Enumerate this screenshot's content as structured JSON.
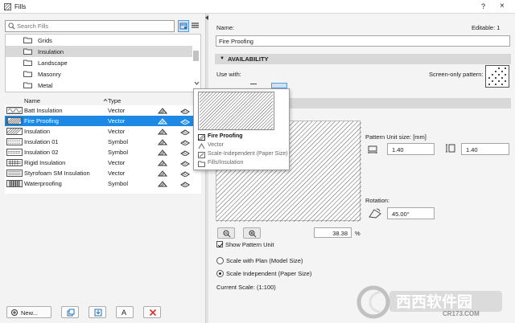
{
  "window": {
    "title": "Fills",
    "help": "?",
    "close": "×"
  },
  "search": {
    "placeholder": "Search Fills",
    "value": ""
  },
  "tree": {
    "items": [
      {
        "label": "Grids",
        "selected": false
      },
      {
        "label": "Insulation",
        "selected": true
      },
      {
        "label": "Landscape",
        "selected": false
      },
      {
        "label": "Masonry",
        "selected": false
      },
      {
        "label": "Metal",
        "selected": false
      }
    ]
  },
  "list": {
    "col_name": "Name",
    "col_type": "Type",
    "rows": [
      {
        "name": "Batt Insulation",
        "type": "Vector",
        "selected": false
      },
      {
        "name": "Fire Proofing",
        "type": "Vector",
        "selected": true
      },
      {
        "name": "Insulation",
        "type": "Vector",
        "selected": false
      },
      {
        "name": "Insulation 01",
        "type": "Symbol",
        "selected": false
      },
      {
        "name": "Insulation 02",
        "type": "Symbol",
        "selected": false
      },
      {
        "name": "Rigid Insulation",
        "type": "Vector",
        "selected": false
      },
      {
        "name": "Styrofoam SM Insulation",
        "type": "Vector",
        "selected": false
      },
      {
        "name": "Waterproofing",
        "type": "Symbol",
        "selected": false
      }
    ]
  },
  "bottom": {
    "new_label": "New...",
    "text_icon_label": "A"
  },
  "settings": {
    "name_label": "Name:",
    "editable": "Editable: 1",
    "name_value": "Fire Proofing",
    "availability_label": "AVAILABILITY",
    "use_with": "Use with:",
    "screen_only": "Screen-only pattern:",
    "pattern_unit_label": "Pattern Unit size: [mm]",
    "unit_w": "1.40",
    "unit_h": "1.40",
    "rotation_label": "Rotation:",
    "rotation_value": "45.00°",
    "zoom_value": "38.38",
    "zoom_unit": "%",
    "show_pattern_unit": "Show Pattern Unit",
    "scale_plan": "Scale with Plan (Model Size)",
    "scale_independent": "Scale Independent (Paper Size)",
    "current_scale": "Current Scale: (1:100)"
  },
  "popup": {
    "name": "Fire Proofing",
    "type": "Vector",
    "scale": "Scale-Independent (Paper Size)",
    "folder": "Fills/Insulation"
  },
  "watermark": {
    "text1": "西西软件园",
    "text2": "CR173.COM"
  },
  "colors": {
    "selection": "#1e88e5",
    "accent": "#1e88e5"
  }
}
